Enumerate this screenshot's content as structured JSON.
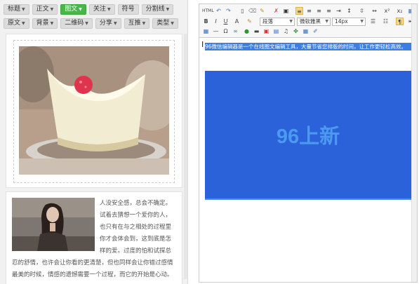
{
  "categories_row1": [
    {
      "label": "标题",
      "active": false
    },
    {
      "label": "正文",
      "active": false
    },
    {
      "label": "图文",
      "active": true
    },
    {
      "label": "关注",
      "active": false
    },
    {
      "label": "符号",
      "active": false,
      "caret": false
    },
    {
      "label": "分割线",
      "active": false
    }
  ],
  "categories_row2": [
    {
      "label": "原文",
      "active": false
    },
    {
      "label": "背景",
      "active": false
    },
    {
      "label": "二维码",
      "active": false
    },
    {
      "label": "分享",
      "active": false
    },
    {
      "label": "互推",
      "active": false
    },
    {
      "label": "类型",
      "active": false
    }
  ],
  "card2": {
    "line1": "人没安全感，总会不确定。",
    "line2": "试着去猜想一个爱你的人，",
    "line3": "也只有在与之相处的过程里",
    "line4": "你才会体会到，这到底是怎",
    "line5": "样的爱。过度的怕和试探总",
    "line6": "忍的舒情，也许会让你看的更清楚，但也同样会让你错过感情",
    "line7": "最美的时候，情感的遗憾需要一个过程，而它的开始是心动。"
  },
  "editor": {
    "selected_paragraph": "96微信编辑器是一个在线图文编辑工具，大量节省您排版的时间，让工作更轻松高效。",
    "banner_text": "96上新"
  },
  "toolbar": {
    "paragraph_select": "段落",
    "font_select": "微软雅黑",
    "size_select": "14px"
  },
  "colors": {
    "active_category": "#49b649",
    "selection": "#3e7ee0",
    "banner_bg": "#2b62d9",
    "banner_text": "#4a9aef"
  }
}
